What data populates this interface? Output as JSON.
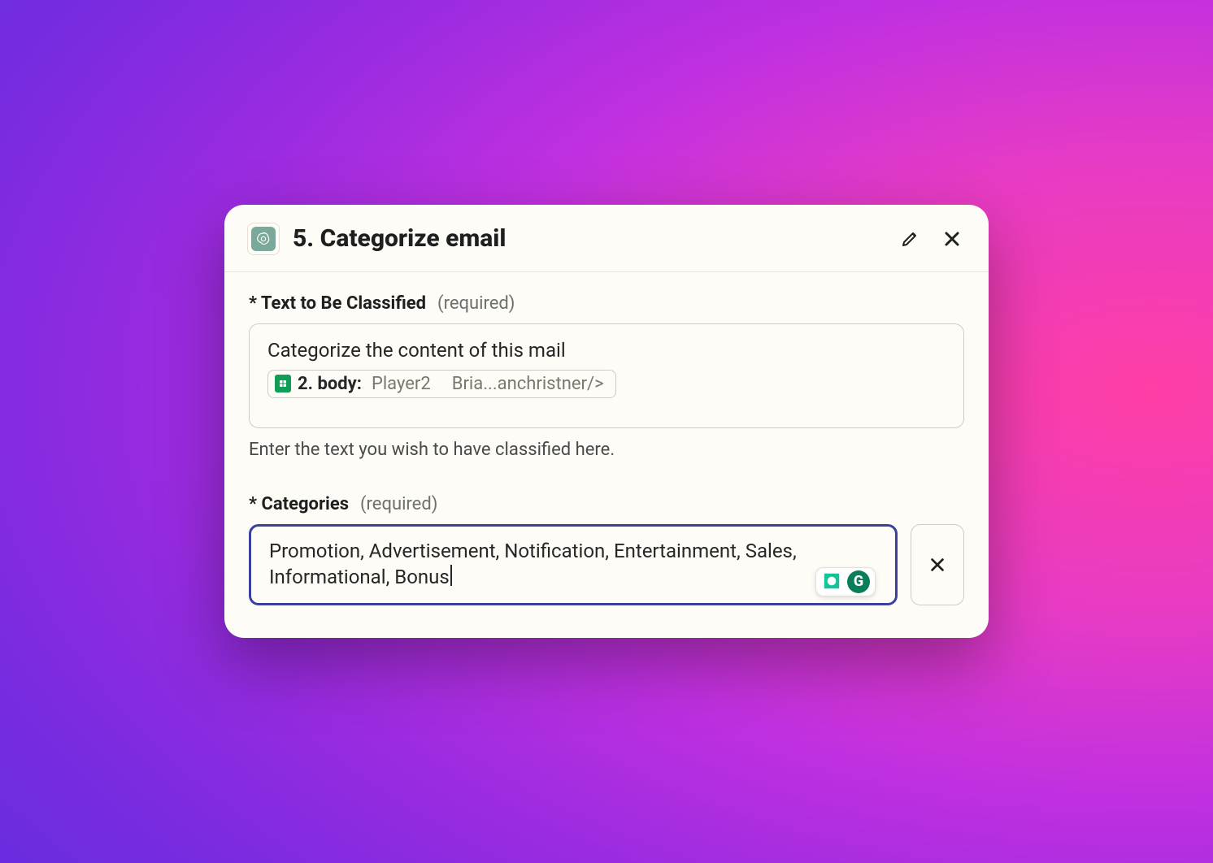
{
  "header": {
    "title": "5. Categorize email"
  },
  "fields": {
    "text_to_classify": {
      "label": "* Text to Be Classified",
      "required_tag": "(required)",
      "prompt_line": "Categorize the content of this mail",
      "pill_key": "2. body:",
      "pill_val1": "Player2",
      "pill_val2": "Bria...anchristner/>",
      "helper": "Enter the text you wish to have classified here."
    },
    "categories": {
      "label": "* Categories",
      "required_tag": "(required)",
      "value": "Promotion, Advertisement, Notification, Entertainment, Sales, Informational, Bonus"
    }
  },
  "grammarly": {
    "letter": "G"
  }
}
